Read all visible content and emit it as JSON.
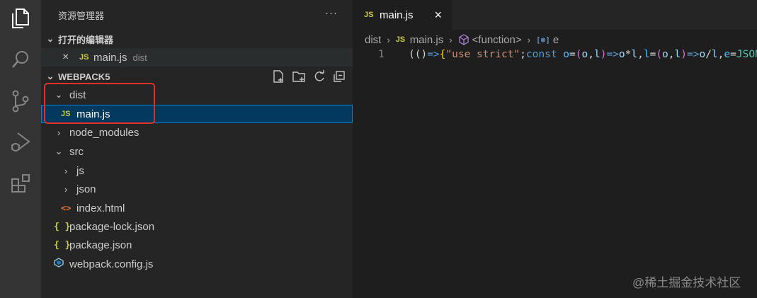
{
  "sidebar": {
    "title": "资源管理器",
    "more": "···",
    "open_editors": {
      "label": "打开的编辑器",
      "items": [
        {
          "icon": "JS",
          "name": "main.js",
          "desc": "dist"
        }
      ]
    },
    "project": {
      "label": "WEBPACK5",
      "tree": {
        "dist": "dist",
        "main_js": "main.js",
        "node_modules": "node_modules",
        "src": "src",
        "js": "js",
        "json": "json",
        "index_html": "index.html",
        "package_lock": "package-lock.json",
        "package_json": "package.json",
        "webpack_config": "webpack.config.js"
      },
      "icons": {
        "js": "JS",
        "json": "{ }",
        "html": "<>"
      }
    }
  },
  "editor": {
    "tab": {
      "icon": "JS",
      "label": "main.js"
    },
    "breadcrumb": {
      "dist": "dist",
      "file": "main.js",
      "fn": "<function>",
      "sym": "e"
    },
    "line_number": "1",
    "code": {
      "t1": "(()",
      "t2": "=>",
      "t3": "{",
      "t4": "\"use strict\"",
      "t5": ";",
      "t6": "const ",
      "t7": "o",
      "t8": "=",
      "t9": "(",
      "t10": "o",
      "t11": ",",
      "t12": "l",
      "t13": ")",
      "t14": "=>",
      "t15": "o",
      "t16": "*",
      "t17": "l",
      "t18": ",",
      "t19": "l",
      "t20": "=",
      "t21": "(",
      "t22": "o",
      "t23": ",",
      "t24": "l",
      "t25": ")",
      "t26": "=>",
      "t27": "o",
      "t28": "/",
      "t29": "l",
      "t30": ",",
      "t31": "e",
      "t32": "=",
      "t33": "JSON"
    }
  },
  "watermark": "@稀土掘金技术社区",
  "colors": {
    "selection": "#04395e",
    "highlight_box": "#e0302a",
    "accent_js": "#cbcb41"
  }
}
